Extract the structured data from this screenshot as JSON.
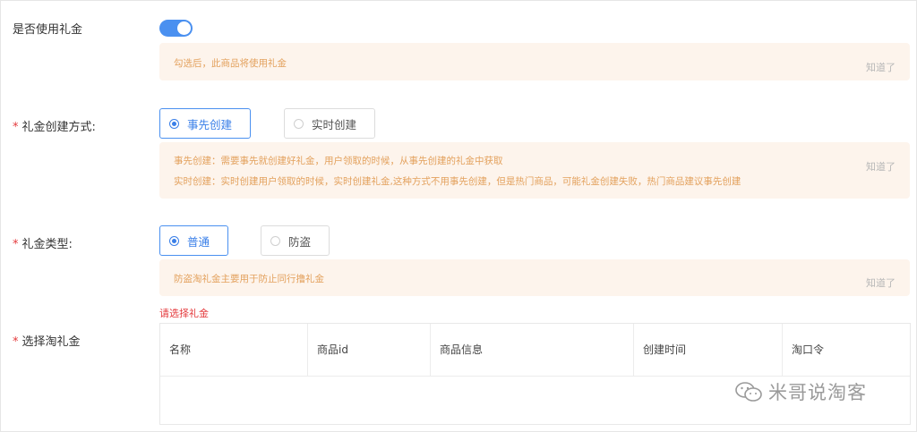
{
  "use_gift": {
    "label": "是否使用礼金",
    "enabled": true,
    "notice": "勾选后，此商品将使用礼金",
    "dismiss": "知道了"
  },
  "create_method": {
    "label": "礼金创建方式:",
    "options": [
      "事先创建",
      "实时创建"
    ],
    "selected": "事先创建",
    "notice_lines": [
      "事先创建：需要事先就创建好礼金，用户领取的时候，从事先创建的礼金中获取",
      "实时创建：实时创建用户领取的时候，实时创建礼金,这种方式不用事先创建，但是热门商品，可能礼金创建失败，热门商品建议事先创建"
    ],
    "dismiss": "知道了"
  },
  "gift_type": {
    "label": "礼金类型:",
    "options": [
      "普通",
      "防盗"
    ],
    "selected": "普通",
    "notice": "防盗淘礼金主要用于防止同行撸礼金",
    "dismiss": "知道了"
  },
  "select_gift": {
    "label": "选择淘礼金",
    "error": "请选择礼金",
    "columns": [
      "名称",
      "商品id",
      "商品信息",
      "创建时间",
      "淘口令"
    ]
  },
  "watermark": "米哥说淘客",
  "colors": {
    "accent": "#4a90f0",
    "notice_bg": "#fdf4ec",
    "notice_text": "#e3a15d",
    "required": "#e4393c"
  }
}
